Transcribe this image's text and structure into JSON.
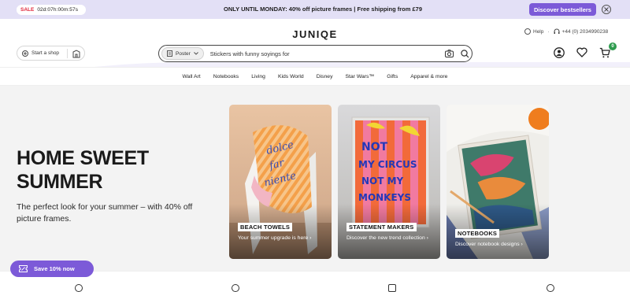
{
  "promo": {
    "sale_label": "SALE",
    "countdown": "02d:07h:00m:57s",
    "message": "ONLY UNTIL MONDAY: 40% off picture frames | Free shipping from £79",
    "cta": "Discover bestsellers"
  },
  "header": {
    "logo": "JUNIQE",
    "help": "Help",
    "phone": "+44 (0) 2034990238",
    "start_shop": "Start a shop",
    "search": {
      "category": "Poster",
      "value": "Stickers with funny soyings for"
    }
  },
  "nav": {
    "items": [
      "Wall Art",
      "Notebooks",
      "Living",
      "Kids World",
      "Disney",
      "Star Wars™",
      "Gifts",
      "Apparel & more"
    ]
  },
  "hero": {
    "title": "HOME SWEET SUMMER",
    "subtitle": "The perfect look for your summer – with 40% off picture frames.",
    "cards": [
      {
        "tag": "BEACH TOWELS",
        "desc": "Your summer upgrade is here ›"
      },
      {
        "tag": "STATEMENT MAKERS",
        "desc": "Discover the new trend collection ›"
      },
      {
        "tag": "NOTEBOOKS",
        "desc": "Discover notebook designs ›"
      }
    ],
    "poster_text": [
      "NOT",
      "MY CIRCUS",
      "NOT MY",
      "MONKEYS"
    ],
    "towel_text": [
      "dolce",
      "far",
      "niente"
    ]
  },
  "cart": {
    "count": "0"
  },
  "save_button": "Save 10% now",
  "colors": {
    "accent": "#7c5ad8",
    "promo_bg": "#e3e0f6",
    "sale_red": "#e0263b",
    "cart_green": "#2e9b4e"
  }
}
